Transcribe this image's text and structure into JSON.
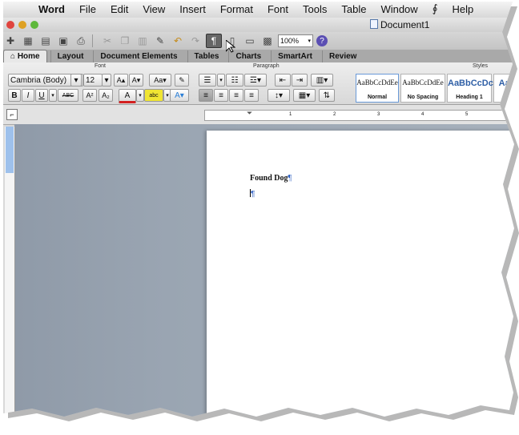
{
  "menubar": {
    "apple": "",
    "app": "Word",
    "items": [
      "File",
      "Edit",
      "View",
      "Insert",
      "Format",
      "Font",
      "Tools",
      "Table",
      "Window",
      "Help"
    ]
  },
  "window": {
    "title": "Document1"
  },
  "toolbar": {
    "zoom": "100%"
  },
  "ribbon": {
    "tabs": [
      "Home",
      "Layout",
      "Document Elements",
      "Tables",
      "Charts",
      "SmartArt",
      "Review"
    ],
    "groups": {
      "font": "Font",
      "paragraph": "Paragraph",
      "styles": "Styles"
    },
    "font_name": "Cambria (Body)",
    "font_size": "12",
    "styles": [
      {
        "sample": "AaBbCcDdEe",
        "name": "Normal"
      },
      {
        "sample": "AaBbCcDdEe",
        "name": "No Spacing"
      },
      {
        "sample": "AaBbCcDc",
        "name": "Heading 1"
      },
      {
        "sample": "AaBb",
        "name": "He"
      }
    ]
  },
  "document": {
    "line1": "Found Dog",
    "pilcrow": "¶"
  },
  "ruler": {
    "marks": [
      "1",
      "2",
      "3",
      "4",
      "5"
    ]
  }
}
